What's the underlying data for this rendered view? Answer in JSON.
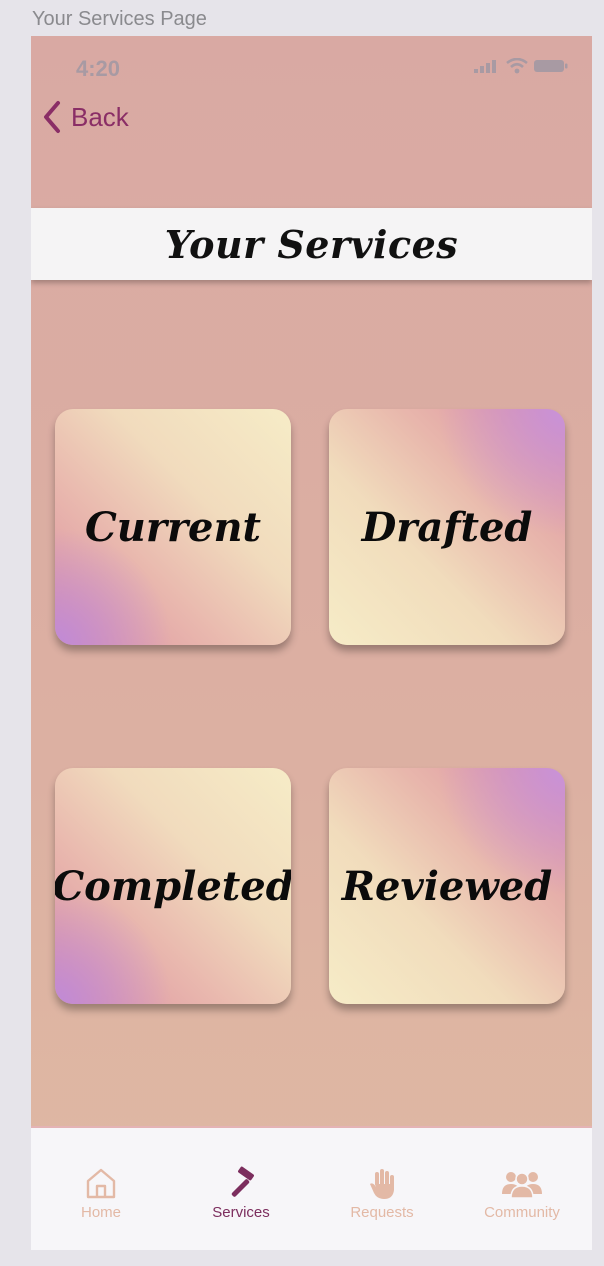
{
  "frame": {
    "label": "Your Services Page"
  },
  "status_bar": {
    "time": "4:20",
    "icons": [
      "signal-icon",
      "wifi-icon",
      "battery-icon"
    ]
  },
  "nav": {
    "back_label": "Back"
  },
  "header": {
    "title": "Your Services"
  },
  "cards": [
    {
      "label": "Current"
    },
    {
      "label": "Drafted"
    },
    {
      "label": "Completed"
    },
    {
      "label": "Reviewed"
    }
  ],
  "tab_bar": {
    "items": [
      {
        "label": "Home",
        "icon": "home-icon",
        "active": false
      },
      {
        "label": "Services",
        "icon": "hammer-icon",
        "active": true
      },
      {
        "label": "Requests",
        "icon": "hand-icon",
        "active": false
      },
      {
        "label": "Community",
        "icon": "community-icon",
        "active": false
      }
    ],
    "active_color": "#7c2e5e",
    "inactive_color": "#e3b9a6"
  },
  "colors": {
    "phone_background": "#d9a9a3",
    "accent": "#8a2e66",
    "title_bar": "#f5f4f5",
    "status_text": "#a89aa3"
  }
}
